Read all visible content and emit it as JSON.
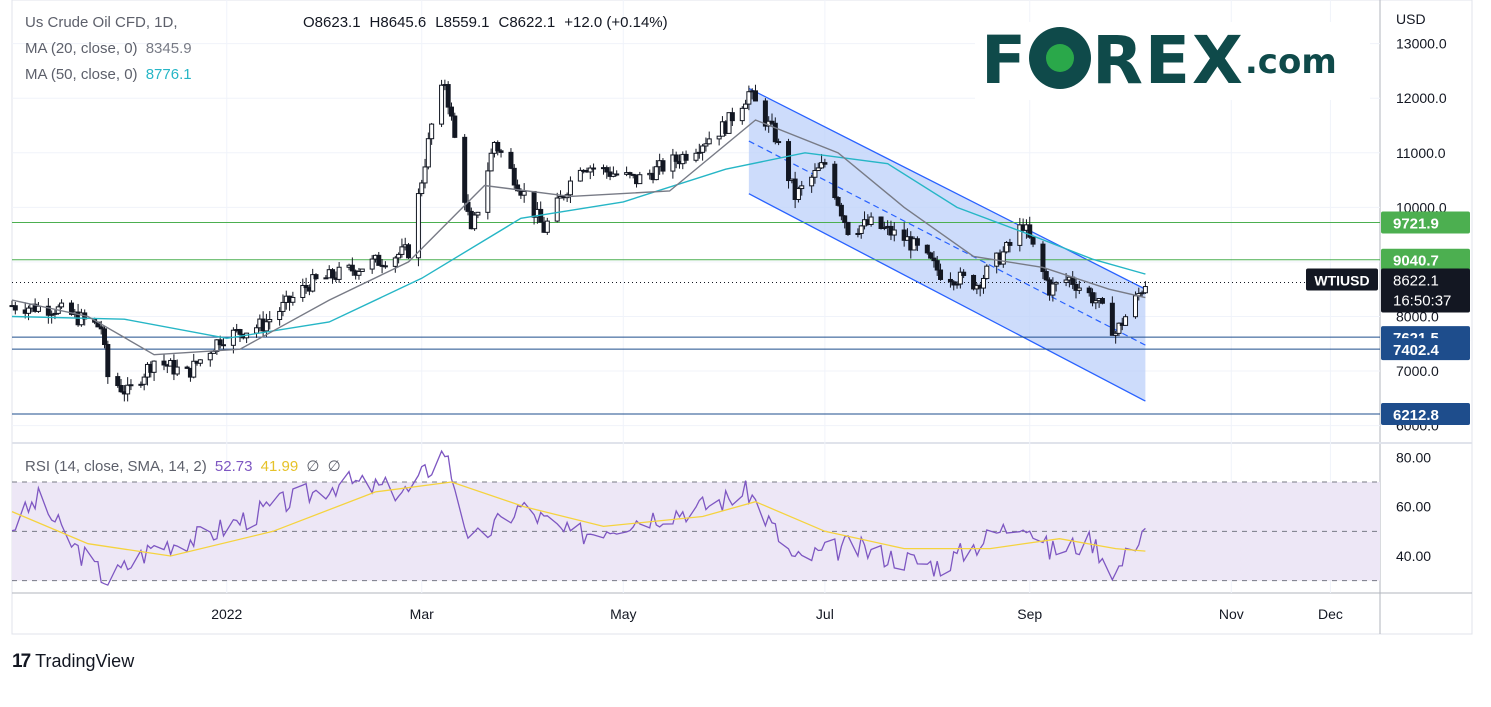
{
  "header": {
    "symbol_title": "Us Crude Oil CFD, 1D,",
    "ohlc": {
      "open": "O8623.1",
      "high": "H8645.6",
      "low": "L8559.1",
      "close": "C8622.1",
      "change": "+12.0 (+0.14%)"
    },
    "ma20_label": "MA (20, close, 0)",
    "ma20_value": "8345.9",
    "ma50_label": "MA (50, close, 0)",
    "ma50_value": "8776.1"
  },
  "brand": {
    "name_part1": "F",
    "name_part2": "REX",
    "suffix": ".com"
  },
  "footer": {
    "tradingview": "TradingView"
  },
  "rsi_legend": {
    "label": "RSI (14, close, SMA, 14, 2)",
    "rsi_value": "52.73",
    "sma_value": "41.99",
    "extra1": "∅",
    "extra2": "∅"
  },
  "colors": {
    "up": "#131722",
    "down": "#131722",
    "ma20": "#787b86",
    "ma50": "#26b6c6",
    "channel_fill": "#bcd0fa",
    "channel_line": "#2962ff",
    "hline_green": "#4caf50",
    "hline_blue": "#1e4d8c",
    "rsi": "#7e57c2",
    "rsi_sma": "#f5d33e",
    "rsi_band": "#ede7f6"
  },
  "chart_data": {
    "type": "candlestick",
    "currency_label": "USD",
    "price_axis": {
      "min": 6000,
      "max": 13000,
      "ticks": [
        "13000.0",
        "12000.0",
        "11000.0",
        "10000.0",
        "9000.0",
        "8000.0",
        "7000.0",
        "6000.0"
      ]
    },
    "time_axis_labels": [
      {
        "label": "2022",
        "date": "2022-01-01"
      },
      {
        "label": "Mar",
        "date": "2022-03-01"
      },
      {
        "label": "May",
        "date": "2022-05-01"
      },
      {
        "label": "Jul",
        "date": "2022-07-01"
      },
      {
        "label": "Sep",
        "date": "2022-09-01"
      },
      {
        "label": "Nov",
        "date": "2022-11-01"
      },
      {
        "label": "Dec",
        "date": "2022-12-01"
      }
    ],
    "time_range": [
      "2021-10-28",
      "2022-12-16"
    ],
    "key_prices": [
      {
        "price": "9721.9",
        "value": 9721.9,
        "style": "green"
      },
      {
        "price": "9040.7",
        "value": 9040.7,
        "style": "green"
      },
      {
        "price": "7621.5",
        "value": 7621.5,
        "style": "blue"
      },
      {
        "price": "7402.4",
        "value": 7402.4,
        "style": "blue"
      },
      {
        "price": "6212.8",
        "value": 6212.8,
        "style": "blue"
      }
    ],
    "last_price_tag": {
      "symbol": "WTIUSD",
      "price": "8622.1",
      "countdown": "16:50:37",
      "value": 8622.1
    },
    "channel": {
      "upper": [
        [
          "2022-06-08",
          12180
        ],
        [
          "2022-10-06",
          8500
        ]
      ],
      "lower": [
        [
          "2022-06-08",
          10250
        ],
        [
          "2022-10-06",
          6450
        ]
      ]
    },
    "closes": [
      [
        "2021-10-28",
        8200
      ],
      [
        "2021-11-10",
        8150
      ],
      [
        "2021-11-24",
        7800
      ],
      [
        "2021-11-26",
        6900
      ],
      [
        "2021-12-02",
        6600
      ],
      [
        "2021-12-10",
        7200
      ],
      [
        "2021-12-20",
        6950
      ],
      [
        "2021-12-30",
        7600
      ],
      [
        "2022-01-12",
        7850
      ],
      [
        "2022-01-26",
        8600
      ],
      [
        "2022-02-10",
        8900
      ],
      [
        "2022-02-25",
        9200
      ],
      [
        "2022-03-04",
        11500
      ],
      [
        "2022-03-08",
        12300
      ],
      [
        "2022-03-16",
        9500
      ],
      [
        "2022-03-23",
        11200
      ],
      [
        "2022-04-07",
        9600
      ],
      [
        "2022-04-18",
        10800
      ],
      [
        "2022-05-05",
        10500
      ],
      [
        "2022-05-18",
        10900
      ],
      [
        "2022-06-01",
        11500
      ],
      [
        "2022-06-08",
        12100
      ],
      [
        "2022-06-16",
        11300
      ],
      [
        "2022-06-22",
        10200
      ],
      [
        "2022-07-01",
        10800
      ],
      [
        "2022-07-08",
        9600
      ],
      [
        "2022-07-15",
        9700
      ],
      [
        "2022-07-26",
        9400
      ],
      [
        "2022-08-05",
        8800
      ],
      [
        "2022-08-16",
        8600
      ],
      [
        "2022-08-26",
        9300
      ],
      [
        "2022-08-30",
        9700
      ],
      [
        "2022-09-07",
        8500
      ],
      [
        "2022-09-13",
        8700
      ],
      [
        "2022-09-21",
        8300
      ],
      [
        "2022-09-27",
        7700
      ],
      [
        "2022-10-03",
        8300
      ],
      [
        "2022-10-06",
        8622
      ]
    ],
    "ma20": [
      [
        "2021-10-28",
        8300
      ],
      [
        "2021-11-20",
        8000
      ],
      [
        "2021-12-10",
        7300
      ],
      [
        "2022-01-05",
        7400
      ],
      [
        "2022-02-01",
        8300
      ],
      [
        "2022-02-25",
        9000
      ],
      [
        "2022-03-20",
        10400
      ],
      [
        "2022-04-15",
        10200
      ],
      [
        "2022-05-15",
        10300
      ],
      [
        "2022-06-10",
        11600
      ],
      [
        "2022-07-05",
        11000
      ],
      [
        "2022-07-25",
        10000
      ],
      [
        "2022-08-15",
        9100
      ],
      [
        "2022-09-05",
        8900
      ],
      [
        "2022-09-25",
        8500
      ],
      [
        "2022-10-06",
        8346
      ]
    ],
    "ma50": [
      [
        "2021-10-28",
        8000
      ],
      [
        "2021-12-01",
        7950
      ],
      [
        "2022-01-01",
        7600
      ],
      [
        "2022-02-01",
        7900
      ],
      [
        "2022-03-01",
        8700
      ],
      [
        "2022-03-31",
        9800
      ],
      [
        "2022-05-01",
        10100
      ],
      [
        "2022-06-01",
        10700
      ],
      [
        "2022-06-25",
        11000
      ],
      [
        "2022-07-20",
        10800
      ],
      [
        "2022-08-10",
        10000
      ],
      [
        "2022-09-01",
        9500
      ],
      [
        "2022-09-20",
        9050
      ],
      [
        "2022-10-06",
        8776
      ]
    ],
    "rsi_axis": {
      "min": 25,
      "max": 85,
      "ticks": [
        "80.00",
        "60.00",
        "40.00"
      ],
      "band": [
        30,
        70
      ],
      "mid": 50
    },
    "rsi": [
      [
        "2021-10-28",
        52
      ],
      [
        "2021-11-05",
        63
      ],
      [
        "2021-11-15",
        45
      ],
      [
        "2021-11-26",
        30
      ],
      [
        "2021-12-10",
        44
      ],
      [
        "2021-12-25",
        48
      ],
      [
        "2022-01-15",
        60
      ],
      [
        "2022-02-05",
        70
      ],
      [
        "2022-02-25",
        66
      ],
      [
        "2022-03-08",
        83
      ],
      [
        "2022-03-16",
        45
      ],
      [
        "2022-03-31",
        60
      ],
      [
        "2022-04-15",
        48
      ],
      [
        "2022-05-05",
        55
      ],
      [
        "2022-05-25",
        60
      ],
      [
        "2022-06-08",
        66
      ],
      [
        "2022-06-22",
        38
      ],
      [
        "2022-07-08",
        44
      ],
      [
        "2022-07-20",
        40
      ],
      [
        "2022-08-05",
        36
      ],
      [
        "2022-08-20",
        48
      ],
      [
        "2022-08-30",
        55
      ],
      [
        "2022-09-07",
        42
      ],
      [
        "2022-09-20",
        46
      ],
      [
        "2022-09-27",
        33
      ],
      [
        "2022-10-06",
        52.73
      ]
    ],
    "rsi_sma": [
      [
        "2021-10-28",
        58
      ],
      [
        "2021-11-20",
        45
      ],
      [
        "2021-12-15",
        40
      ],
      [
        "2022-01-15",
        50
      ],
      [
        "2022-02-15",
        66
      ],
      [
        "2022-03-10",
        70
      ],
      [
        "2022-04-01",
        60
      ],
      [
        "2022-04-25",
        52
      ],
      [
        "2022-05-25",
        56
      ],
      [
        "2022-06-10",
        62
      ],
      [
        "2022-07-01",
        50
      ],
      [
        "2022-07-25",
        43
      ],
      [
        "2022-08-20",
        43
      ],
      [
        "2022-09-10",
        47
      ],
      [
        "2022-09-27",
        43
      ],
      [
        "2022-10-06",
        41.99
      ]
    ]
  }
}
